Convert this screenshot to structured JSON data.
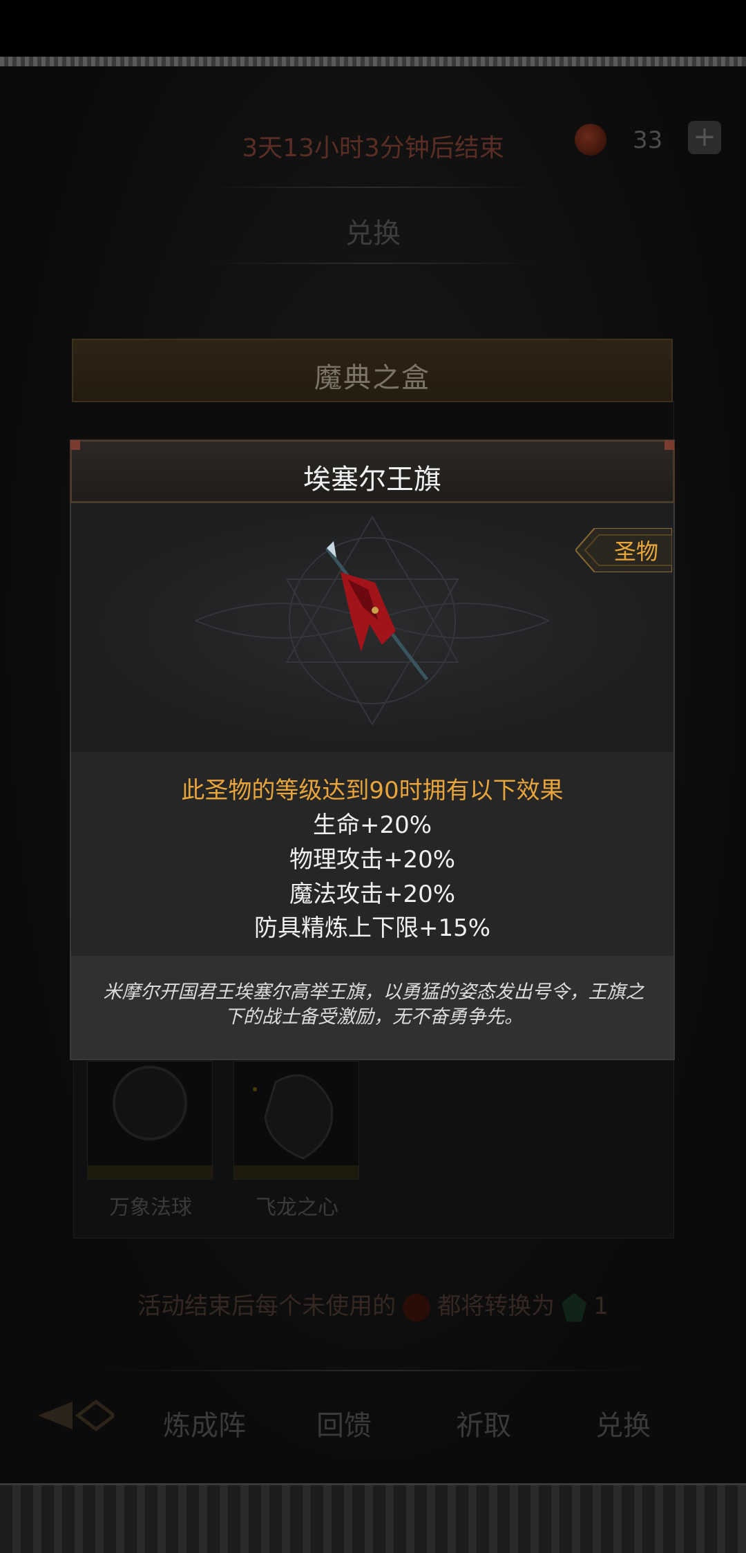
{
  "background": {
    "countdown": "3天13小时3分钟后结束",
    "currency": {
      "amount": "33",
      "plus_label": "+"
    },
    "exchange_title": "兑换",
    "box_title": "魔典之盒",
    "cards": [
      {
        "label": "万象法球"
      },
      {
        "label": "飞龙之心"
      }
    ],
    "notice_prefix": "活动结束后每个未使用的",
    "notice_middle": "都将转换为",
    "notice_suffix": "1",
    "nav": [
      "炼成阵",
      "回馈",
      "祈取",
      "兑换"
    ]
  },
  "item": {
    "name": "埃塞尔王旗",
    "rarity": "圣物",
    "effects_heading": "此圣物的等级达到90时拥有以下效果",
    "effects": [
      "生命+20%",
      "物理攻击+20%",
      "魔法攻击+20%",
      "防具精炼上下限+15%"
    ],
    "description": "米摩尔开国君王埃塞尔高举王旗，以勇猛的姿态发出号令，王旗之下的战士备受激励，无不奋勇争先。"
  },
  "colors": {
    "accent_orange": "#e8a53b",
    "text_white": "#f0f0f0",
    "flag_red": "#a3141a"
  },
  "icons": {
    "flag": "banner-spear-icon",
    "rarity": "rarity-ribbon-icon",
    "currency": "blood-gem-icon",
    "back": "back-arrow-icon"
  }
}
